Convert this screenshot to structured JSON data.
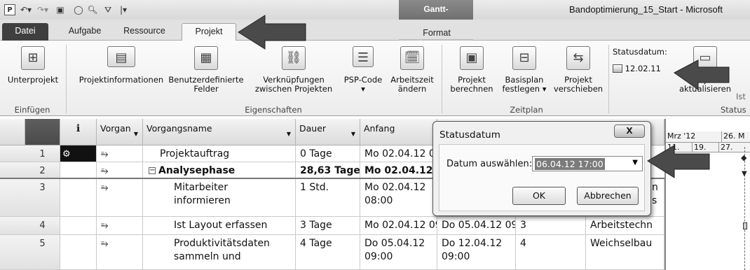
{
  "window": {
    "title": "Bandoptimierung_15_Start - Microsoft",
    "context_header": "Gantt-Diagrammtools",
    "qat_icons": [
      "project-icon",
      "undo-icon",
      "redo-icon",
      "save-icon",
      "circle-icon",
      "print-preview-icon",
      "filter-icon",
      "customize-icon"
    ]
  },
  "tabs": [
    {
      "label": "Datei"
    },
    {
      "label": "Aufgabe"
    },
    {
      "label": "Ressource"
    },
    {
      "label": "Projekt"
    },
    {
      "label": "Format"
    }
  ],
  "ribbon": {
    "groups": {
      "einfuegen": "Einfügen",
      "eigenschaften": "Eigenschaften",
      "zeitplan": "Zeitplan",
      "status": "Status"
    },
    "buttons": {
      "unterprojekt": "Unterprojekt",
      "projektinfo": "Projektinformationen",
      "benutzerdef_l1": "Benutzerdefinierte",
      "benutzerdef_l2": "Felder",
      "verkn_l1": "Verknüpfungen",
      "verkn_l2": "zwischen Projekten",
      "psp_l1": "PSP-Code",
      "psp_l2": "▾",
      "arbeitszeit_l1": "Arbeitszeit",
      "arbeitszeit_l2": "ändern",
      "berechnen_l1": "Projekt",
      "berechnen_l2": "berechnen",
      "basisplan_l1": "Basisplan",
      "basisplan_l2": "festlegen ▾",
      "verschieben_l1": "Projekt",
      "verschieben_l2": "verschieben",
      "statusdatum_label": "Statusdatum:",
      "statusdatum_value": "12.02.11",
      "aktualisieren_l1": "Projekt",
      "aktualisieren_l2": "aktualisieren",
      "ist_partial": "Ist"
    }
  },
  "table": {
    "headers": {
      "info": "ℹ",
      "mode": "Vorgan",
      "name": "Vorgangsname",
      "dauer": "Dauer",
      "anfang": "Anfang"
    },
    "rows": [
      {
        "num": "1",
        "name": "Projektauftrag",
        "dauer": "0 Tage",
        "anfang": "Mo 02.04.12 0",
        "ende": "",
        "vorg": "",
        "res": ""
      },
      {
        "num": "2",
        "name": "Analysephase",
        "dauer": "28,63 Tage",
        "anfang": "Mo 02.04.12",
        "ende": "",
        "vorg": "",
        "res": ""
      },
      {
        "num": "3",
        "name_l1": "Mitarbeiter",
        "name_l2": "informieren",
        "dauer": "1 Std.",
        "anfang_l1": "Mo 02.04.12",
        "anfang_l2": "08:00",
        "res_l1": "n",
        "res_l2": "s"
      },
      {
        "num": "4",
        "name": "Ist Layout erfassen",
        "dauer": "3 Tage",
        "anfang": "Mo 02.04.12 09",
        "ende": "Do 05.04.12 09:",
        "vorg": "3",
        "res": "Arbeitstechn"
      },
      {
        "num": "5",
        "name_l1": "Produktivitätsdaten",
        "name_l2": "sammeln und",
        "dauer": "4 Tage",
        "anfang_l1": "Do 05.04.12",
        "anfang_l2": "09:00",
        "ende_l1": "Do 12.04.12",
        "ende_l2": "09:00",
        "vorg": "4",
        "res": "Weichselbau"
      }
    ]
  },
  "gantt": {
    "month_1": "Mrz '12",
    "month_2": "26. M",
    "days": [
      "11.",
      "19.",
      "27."
    ]
  },
  "dialog": {
    "title": "Statusdatum",
    "close": "X",
    "label": "Datum auswählen:",
    "value": "06.04.12 17:00",
    "ok": "OK",
    "cancel": "Abbrechen"
  }
}
